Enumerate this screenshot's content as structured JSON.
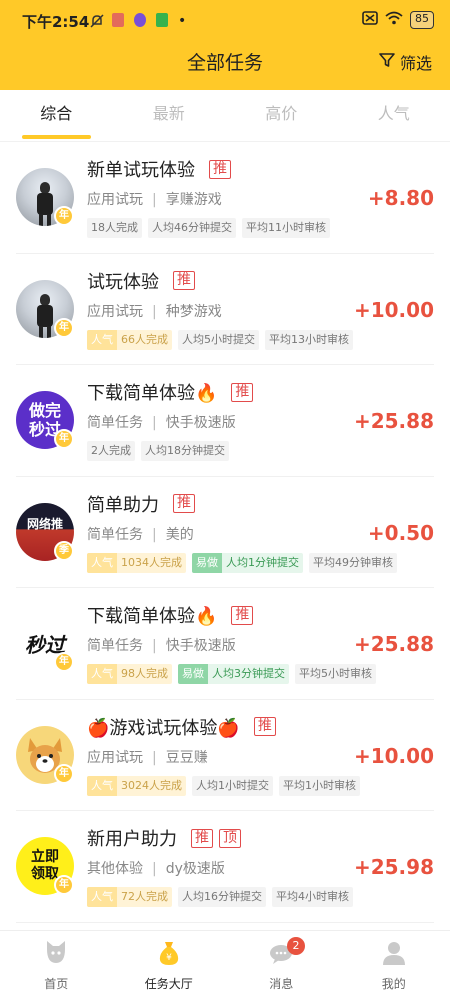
{
  "status_bar": {
    "time": "下午2:54",
    "dot": "•",
    "battery": "85"
  },
  "header": {
    "title": "全部任务",
    "filter_label": "筛选"
  },
  "tabs": [
    {
      "label": "综合",
      "active": true
    },
    {
      "label": "最新",
      "active": false
    },
    {
      "label": "高价",
      "active": false
    },
    {
      "label": "人气",
      "active": false
    }
  ],
  "tasks": [
    {
      "title": "新单试玩体验",
      "tags": [
        "推"
      ],
      "category": "应用试玩",
      "app": "享赚游戏",
      "price": "+8.80",
      "badge": "年",
      "hot_label": "",
      "completed": "18人完成",
      "easy_label": "",
      "submit": "人均46分钟提交",
      "review": "平均11小时审核"
    },
    {
      "title": "试玩体验",
      "tags": [
        "推"
      ],
      "category": "应用试玩",
      "app": "种梦游戏",
      "price": "+10.00",
      "badge": "年",
      "hot_label": "人气",
      "completed": "66人完成",
      "easy_label": "",
      "submit": "人均5小时提交",
      "review": "平均13小时审核"
    },
    {
      "title": "下载简单体验🔥",
      "tags": [
        "推"
      ],
      "category": "简单任务",
      "app": "快手极速版",
      "price": "+25.88",
      "badge": "年",
      "avatar_text": "做完\n秒过",
      "hot_label": "",
      "completed": "2人完成",
      "easy_label": "",
      "submit": "人均18分钟提交",
      "review": ""
    },
    {
      "title": "简单助力",
      "tags": [
        "推"
      ],
      "category": "简单任务",
      "app": "美的",
      "price": "+0.50",
      "badge": "季",
      "avatar_text": "网络推",
      "hot_label": "人气",
      "completed": "1034人完成",
      "easy_label": "易做",
      "submit": "人均1分钟提交",
      "review": "平均49分钟审核"
    },
    {
      "title": "下载简单体验🔥",
      "tags": [
        "推"
      ],
      "category": "简单任务",
      "app": "快手极速版",
      "price": "+25.88",
      "badge": "年",
      "avatar_text": "秒过",
      "hot_label": "人气",
      "completed": "98人完成",
      "easy_label": "易做",
      "submit": "人均3分钟提交",
      "review": "平均5小时审核"
    },
    {
      "title": "🍎游戏试玩体验🍎",
      "tags": [
        "推"
      ],
      "category": "应用试玩",
      "app": "豆豆赚",
      "price": "+10.00",
      "badge": "年",
      "hot_label": "人气",
      "completed": "3024人完成",
      "easy_label": "",
      "submit": "人均1小时提交",
      "review": "平均1小时审核"
    },
    {
      "title": "新用户助力",
      "tags": [
        "推",
        "顶"
      ],
      "category": "其他体验",
      "app": "dy极速版",
      "price": "+25.98",
      "badge": "年",
      "avatar_text": "立即\n领取",
      "hot_label": "人气",
      "completed": "72人完成",
      "easy_label": "",
      "submit": "人均16分钟提交",
      "review": "平均4小时审核"
    }
  ],
  "bottom_nav": [
    {
      "label": "首页",
      "icon": "home-cat-icon",
      "active": false
    },
    {
      "label": "任务大厅",
      "icon": "money-bag-icon",
      "active": true
    },
    {
      "label": "消息",
      "icon": "message-icon",
      "active": false,
      "badge": "2"
    },
    {
      "label": "我的",
      "icon": "profile-icon",
      "active": false
    }
  ],
  "colors": {
    "brand": "#FFC928",
    "price": "#E8523F",
    "tag": "#E24B4B"
  }
}
